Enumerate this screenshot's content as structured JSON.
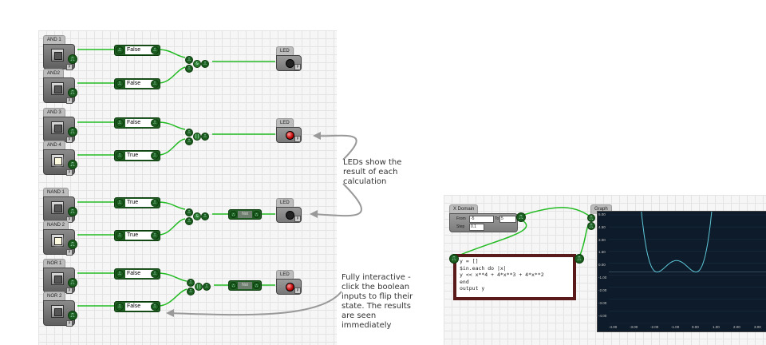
{
  "circuit": {
    "blocks": [
      {
        "title": "AND 1",
        "input_on": false,
        "value": "False",
        "lamp_on": false
      },
      {
        "title": "AND2",
        "input_on": false,
        "value": "False",
        "lamp_on": false
      },
      {
        "title": "AND 3",
        "input_on": false,
        "value": "False",
        "lamp_on": false
      },
      {
        "title": "AND 4",
        "input_on": true,
        "value": "True",
        "lamp_on": true
      },
      {
        "title": "NAND 1",
        "input_on": false,
        "value": "True",
        "lamp_on": false
      },
      {
        "title": "NAND 2",
        "input_on": true,
        "value": "True",
        "lamp_on": false
      },
      {
        "title": "NOR 1",
        "input_on": false,
        "value": "False",
        "lamp_on": false
      },
      {
        "title": "NOR 2",
        "input_on": false,
        "value": "False",
        "lamp_on": false
      }
    ],
    "gates": [
      {
        "symbol": "&"
      },
      {
        "symbol": "||"
      },
      {
        "symbol": "&"
      },
      {
        "symbol": "||"
      }
    ],
    "not_label": "Not",
    "led_title": "LED",
    "leds": [
      {
        "title": "LED",
        "lit": false
      },
      {
        "title": "LED",
        "lit": true
      },
      {
        "title": "LED",
        "lit": false
      },
      {
        "title": "LED",
        "lit": true
      }
    ],
    "port_glyph": "⎍",
    "sub_tag": "P"
  },
  "annotations": {
    "leds": "LEDs show the result of each calculation",
    "interactive": "Fully interactive - click the boolean inputs to flip their state. The results are seen immediately"
  },
  "xdomain": {
    "title": "X Domain",
    "from_label": "From",
    "from_value": "-5",
    "to_label": "To",
    "to_value": "5",
    "step_label": "Step",
    "step_value": "0.1"
  },
  "code": {
    "lines": [
      "y = []",
      "$in.each do |x|",
      "    y << x**4 + 4*x**3 + 4*x**2",
      "end",
      "output y"
    ],
    "status": "ON"
  },
  "graph": {
    "title": "Graph",
    "y_ticks": [
      "5.00",
      "4.50",
      "3.00",
      "1.50",
      "0.00",
      "-1.00",
      "-2.00",
      "-3.00",
      "-4.00"
    ],
    "x_ticks": [
      "-4.00",
      "-3.00",
      "-2.00",
      "-1.00",
      "0.00",
      "1.00",
      "2.00",
      "3.00"
    ],
    "line_color": "#5ec8d8"
  },
  "colors": {
    "wire": "#22bb22",
    "annotation_arrow": "#999999",
    "led_on": "#cc0000"
  }
}
